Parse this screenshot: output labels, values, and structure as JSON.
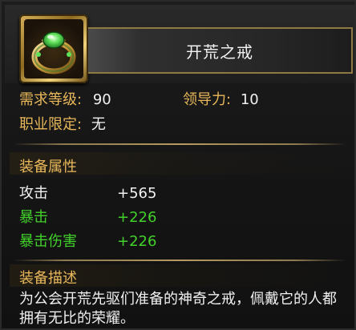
{
  "item": {
    "name": "开荒之戒",
    "icon": "green-gem-ring-icon"
  },
  "requirements": {
    "level_label": "需求等级:",
    "level_value": "90",
    "leadership_label": "领导力:",
    "leadership_value": "10",
    "job_label": "职业限定:",
    "job_value": "无"
  },
  "attributes": {
    "section_title": "装备属性",
    "rows": [
      {
        "label": "攻击",
        "value": "+565",
        "highlight": false
      },
      {
        "label": "暴击",
        "value": "+226",
        "highlight": true
      },
      {
        "label": "暴击伤害",
        "value": "+226",
        "highlight": true
      }
    ]
  },
  "description": {
    "section_title": "装备描述",
    "text": "为公会开荒先驱们准备的神奇之戒，佩戴它的人都拥有无比的荣耀。"
  },
  "colors": {
    "label_gold": "#e8b85a",
    "value_white": "#f2f2f2",
    "bonus_green": "#41d12a"
  }
}
